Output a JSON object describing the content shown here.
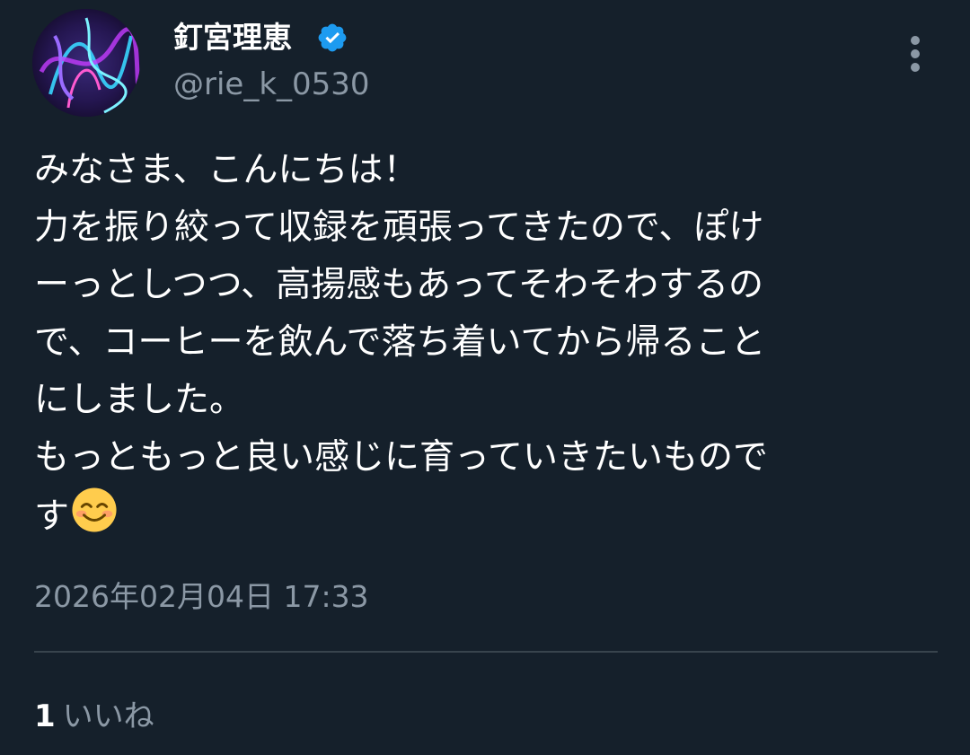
{
  "author": {
    "display_name": "釘宮理恵",
    "handle": "@rie_k_0530",
    "verified": true,
    "avatar_icon": "avatar-image"
  },
  "tweet": {
    "lines": [
      "みなさま、こんにちは！",
      "力を振り絞って収録を頑張ってきたので、ぽけ",
      "ーっとしつつ、高揚感もあってそわそわするの",
      "で、コーヒーを飲んで落ち着いてから帰ること",
      "にしました。",
      "もっともっと良い感じに育っていきたいもので",
      "す"
    ],
    "trailing_emoji": "smiling-face-emoji",
    "timestamp": "2026年02月04日 17:33"
  },
  "engagement": {
    "likes_count": "1",
    "likes_label": "いいね"
  },
  "menu": {
    "icon": "more-vertical-icon"
  },
  "colors": {
    "background": "#15202b",
    "primary_text": "#ffffff",
    "secondary_text": "#8b98a5",
    "divider": "#38444d",
    "verified_badge": "#1d9bf0"
  }
}
